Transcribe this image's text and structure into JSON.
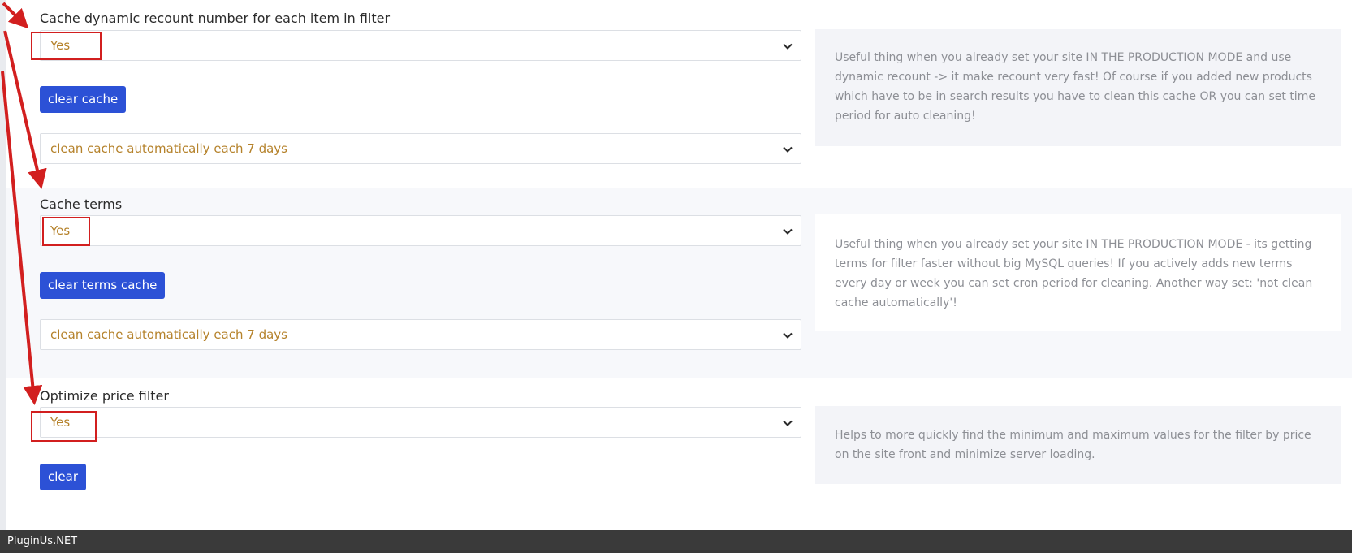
{
  "sections": [
    {
      "label": "Cache dynamic recount number for each item in filter",
      "select_value": "Yes",
      "button_label": "clear cache",
      "auto_clean_value": "clean cache automatically each 7 days",
      "info": "Useful thing when you already set your site IN THE PRODUCTION MODE and use dynamic recount -> it make recount very fast! Of course if you added new products which have to be in search results you have to clean this cache OR you can set time period for auto cleaning!"
    },
    {
      "label": "Cache terms",
      "select_value": "Yes",
      "button_label": "clear terms cache",
      "auto_clean_value": "clean cache automatically each 7 days",
      "info": "Useful thing when you already set your site IN THE PRODUCTION MODE - its getting terms for filter faster without big MySQL queries! If you actively adds new terms every day or week you can set cron period for cleaning. Another way set: 'not clean cache automatically'!"
    },
    {
      "label": "Optimize price filter",
      "select_value": "Yes",
      "button_label": "clear",
      "info": "Helps to more quickly find the minimum and maximum values for the filter by price on the site front and minimize server loading."
    }
  ],
  "footer": {
    "brand": "PluginUs.NET"
  },
  "colors": {
    "accent_button": "#2c51d6",
    "select_text": "#b5822b",
    "annotation_red": "#d21f1f",
    "footer_bg": "#3a3a3a"
  },
  "icons": [
    "chevron-down-icon",
    "annotation-arrow"
  ]
}
